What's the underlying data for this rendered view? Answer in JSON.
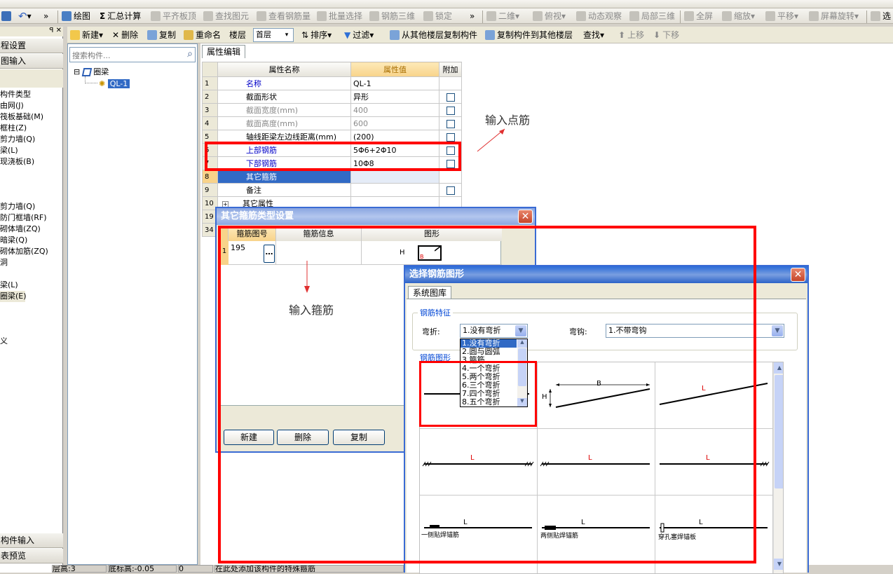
{
  "toolbar1": {
    "items": [
      "绘图",
      "汇总计算",
      "平齐板顶",
      "查找图元",
      "查看钢筋量",
      "批量选择",
      "钢筋三维",
      "锁定",
      "二维",
      "俯视",
      "动态观察",
      "局部三维",
      "全屏",
      "缩放",
      "平移",
      "屏幕旋转",
      "选"
    ]
  },
  "toolbar2": {
    "new": "新建",
    "delete": "删除",
    "copy": "复制",
    "rename": "重命名",
    "floor_label": "楼层",
    "floor_value": "首层",
    "sort": "排序",
    "filter": "过滤",
    "copy_from_floor": "从其他楼层复制构件",
    "copy_to_floor": "复制构件到其他楼层",
    "find": "查找",
    "up": "上移",
    "down": "下移"
  },
  "left_panel": {
    "header1": "程设置",
    "header2": "图输入",
    "items": [
      "构件类型",
      "由网(J)",
      "筏板基础(M)",
      "框柱(Z)",
      "剪力墙(Q)",
      "梁(L)",
      "现浇板(B)",
      "剪力墙(Q)",
      "防门框墙(RF)",
      "砌体墙(ZQ)",
      "暗梁(Q)",
      "砌体加筋(ZQ)",
      "洞",
      "梁(L)",
      "圈梁(E)",
      "义"
    ],
    "footer1": "构件输入",
    "footer2": "表预览"
  },
  "tree": {
    "search_placeholder": "搜索构件...",
    "root": "圈梁",
    "child": "QL-1"
  },
  "prop_tab": "属性编辑",
  "grid": {
    "col_name": "属性名称",
    "col_value": "属性值",
    "col_extra": "附加",
    "rows": [
      {
        "n": "1",
        "name": "名称",
        "value": "QL-1"
      },
      {
        "n": "2",
        "name": "截面形状",
        "value": "异形"
      },
      {
        "n": "3",
        "name": "截面宽度(mm)",
        "value": "400"
      },
      {
        "n": "4",
        "name": "截面高度(mm)",
        "value": "600"
      },
      {
        "n": "5",
        "name": "轴线距梁左边线距离(mm)",
        "value": "(200)"
      },
      {
        "n": "6",
        "name": "上部钢筋",
        "value": "5Φ6+2Φ10"
      },
      {
        "n": "7",
        "name": "下部钢筋",
        "value": "10Φ8"
      },
      {
        "n": "8",
        "name": "其它箍筋",
        "value": ""
      },
      {
        "n": "9",
        "name": "备注",
        "value": ""
      },
      {
        "n": "10",
        "name": "其它属性",
        "value": ""
      },
      {
        "n": "19",
        "name": "",
        "value": ""
      },
      {
        "n": "34",
        "name": "",
        "value": ""
      }
    ]
  },
  "annotations": {
    "point_rebar": "输入点筋",
    "stirrup": "输入箍筋"
  },
  "dialog1": {
    "title": "其它箍筋类型设置",
    "col1": "箍筋图号",
    "col2": "箍筋信息",
    "col3": "图形",
    "row_num": "1",
    "row_code": "195",
    "shape_h": "H",
    "shape_b": "B",
    "btn_new": "新建",
    "btn_delete": "删除",
    "btn_copy": "复制"
  },
  "dialog2": {
    "title": "选择钢筋图形",
    "tab": "系统图库",
    "group1": "钢筋特征",
    "bend_label": "弯折:",
    "bend_value": "1.没有弯折",
    "hook_label": "弯钩:",
    "hook_value": "1.不带弯钩",
    "group2": "钢筋图形",
    "dropdown": [
      "1.没有弯折",
      "2.圆与圆弧",
      "3.箍筋",
      "4.一个弯折",
      "5.两个弯折",
      "6.三个弯折",
      "7.四个弯折",
      "8.五个弯折"
    ],
    "shape_labels": {
      "b": "B",
      "h": "H",
      "l": "L",
      "caption1": "一侧贴焊锚筋",
      "caption2": "两侧贴焊锚筋",
      "caption3": "穿孔塞焊锚板"
    }
  },
  "status": {
    "s1": "层高:3",
    "s2": "底标高:-0.05",
    "s3": "0",
    "s4": "在此处添加该构件的特殊箍筋"
  },
  "colors": {
    "accent": "#ff0000",
    "selected": "#316ac5",
    "title": "#2b6bd8"
  }
}
